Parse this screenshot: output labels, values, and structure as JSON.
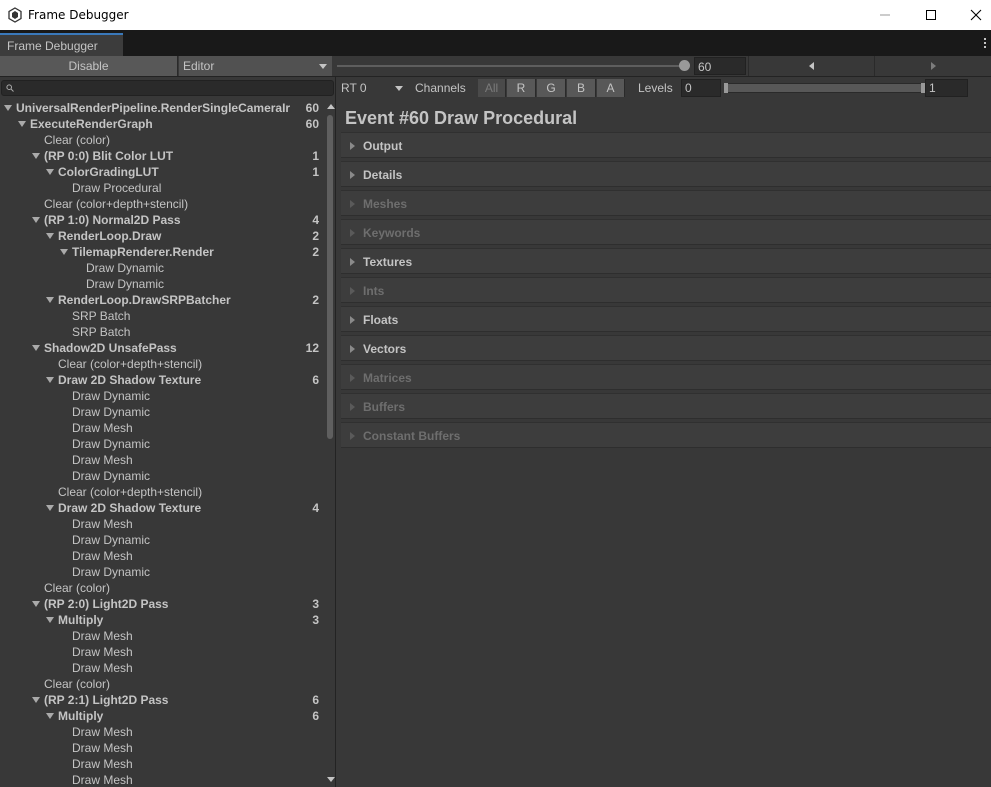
{
  "window": {
    "title": "Frame Debugger"
  },
  "tab": {
    "label": "Frame Debugger"
  },
  "toolbar": {
    "disable_label": "Disable",
    "target_label": "Editor",
    "event_index": "60"
  },
  "render_target": {
    "selected": "RT 0",
    "channels_label": "Channels",
    "channels": [
      "All",
      "R",
      "G",
      "B",
      "A"
    ],
    "levels_label": "Levels",
    "levels_min": "0",
    "levels_max": "1"
  },
  "tree": [
    {
      "depth": 0,
      "label": "UniversalRenderPipeline.RenderSingleCameraIr",
      "count": "60",
      "bold": true,
      "expanded": true
    },
    {
      "depth": 1,
      "label": "ExecuteRenderGraph",
      "count": "60",
      "bold": true,
      "expanded": true
    },
    {
      "depth": 2,
      "label": "Clear (color)",
      "count": "",
      "bold": false
    },
    {
      "depth": 2,
      "label": "(RP 0:0) Blit Color LUT",
      "count": "1",
      "bold": true,
      "expanded": true
    },
    {
      "depth": 3,
      "label": "ColorGradingLUT",
      "count": "1",
      "bold": true,
      "expanded": true
    },
    {
      "depth": 4,
      "label": "Draw Procedural",
      "count": "",
      "bold": false
    },
    {
      "depth": 2,
      "label": "Clear (color+depth+stencil)",
      "count": "",
      "bold": false
    },
    {
      "depth": 2,
      "label": "(RP 1:0) Normal2D Pass",
      "count": "4",
      "bold": true,
      "expanded": true
    },
    {
      "depth": 3,
      "label": "RenderLoop.Draw",
      "count": "2",
      "bold": true,
      "expanded": true
    },
    {
      "depth": 4,
      "label": "TilemapRenderer.Render",
      "count": "2",
      "bold": true,
      "expanded": true
    },
    {
      "depth": 5,
      "label": "Draw Dynamic",
      "count": "",
      "bold": false
    },
    {
      "depth": 5,
      "label": "Draw Dynamic",
      "count": "",
      "bold": false
    },
    {
      "depth": 3,
      "label": "RenderLoop.DrawSRPBatcher",
      "count": "2",
      "bold": true,
      "expanded": true
    },
    {
      "depth": 4,
      "label": "SRP Batch",
      "count": "",
      "bold": false
    },
    {
      "depth": 4,
      "label": "SRP Batch",
      "count": "",
      "bold": false
    },
    {
      "depth": 2,
      "label": "Shadow2D UnsafePass",
      "count": "12",
      "bold": true,
      "expanded": true
    },
    {
      "depth": 3,
      "label": "Clear (color+depth+stencil)",
      "count": "",
      "bold": false
    },
    {
      "depth": 3,
      "label": "Draw 2D Shadow Texture",
      "count": "6",
      "bold": true,
      "expanded": true
    },
    {
      "depth": 4,
      "label": "Draw Dynamic",
      "count": "",
      "bold": false
    },
    {
      "depth": 4,
      "label": "Draw Dynamic",
      "count": "",
      "bold": false
    },
    {
      "depth": 4,
      "label": "Draw Mesh",
      "count": "",
      "bold": false
    },
    {
      "depth": 4,
      "label": "Draw Dynamic",
      "count": "",
      "bold": false
    },
    {
      "depth": 4,
      "label": "Draw Mesh",
      "count": "",
      "bold": false
    },
    {
      "depth": 4,
      "label": "Draw Dynamic",
      "count": "",
      "bold": false
    },
    {
      "depth": 3,
      "label": "Clear (color+depth+stencil)",
      "count": "",
      "bold": false
    },
    {
      "depth": 3,
      "label": "Draw 2D Shadow Texture",
      "count": "4",
      "bold": true,
      "expanded": true
    },
    {
      "depth": 4,
      "label": "Draw Mesh",
      "count": "",
      "bold": false
    },
    {
      "depth": 4,
      "label": "Draw Dynamic",
      "count": "",
      "bold": false
    },
    {
      "depth": 4,
      "label": "Draw Mesh",
      "count": "",
      "bold": false
    },
    {
      "depth": 4,
      "label": "Draw Dynamic",
      "count": "",
      "bold": false
    },
    {
      "depth": 2,
      "label": "Clear (color)",
      "count": "",
      "bold": false
    },
    {
      "depth": 2,
      "label": "(RP 2:0) Light2D Pass",
      "count": "3",
      "bold": true,
      "expanded": true
    },
    {
      "depth": 3,
      "label": "Multiply",
      "count": "3",
      "bold": true,
      "expanded": true
    },
    {
      "depth": 4,
      "label": "Draw Mesh",
      "count": "",
      "bold": false
    },
    {
      "depth": 4,
      "label": "Draw Mesh",
      "count": "",
      "bold": false
    },
    {
      "depth": 4,
      "label": "Draw Mesh",
      "count": "",
      "bold": false
    },
    {
      "depth": 2,
      "label": "Clear (color)",
      "count": "",
      "bold": false
    },
    {
      "depth": 2,
      "label": "(RP 2:1) Light2D Pass",
      "count": "6",
      "bold": true,
      "expanded": true
    },
    {
      "depth": 3,
      "label": "Multiply",
      "count": "6",
      "bold": true,
      "expanded": true
    },
    {
      "depth": 4,
      "label": "Draw Mesh",
      "count": "",
      "bold": false
    },
    {
      "depth": 4,
      "label": "Draw Mesh",
      "count": "",
      "bold": false
    },
    {
      "depth": 4,
      "label": "Draw Mesh",
      "count": "",
      "bold": false
    },
    {
      "depth": 4,
      "label": "Draw Mesh",
      "count": "",
      "bold": false
    }
  ],
  "details": {
    "title": "Event #60 Draw Procedural",
    "sections": [
      {
        "label": "Output",
        "enabled": true
      },
      {
        "label": "Details",
        "enabled": true
      },
      {
        "label": "Meshes",
        "enabled": false
      },
      {
        "label": "Keywords",
        "enabled": false
      },
      {
        "label": "Textures",
        "enabled": true
      },
      {
        "label": "Ints",
        "enabled": false
      },
      {
        "label": "Floats",
        "enabled": true
      },
      {
        "label": "Vectors",
        "enabled": true
      },
      {
        "label": "Matrices",
        "enabled": false
      },
      {
        "label": "Buffers",
        "enabled": false
      },
      {
        "label": "Constant Buffers",
        "enabled": false
      }
    ]
  },
  "colors": {
    "panel_bg": "#383838",
    "tab_accent": "#3a79bb",
    "text": "#c4c4c4",
    "text_disabled": "#6e6e6e"
  }
}
